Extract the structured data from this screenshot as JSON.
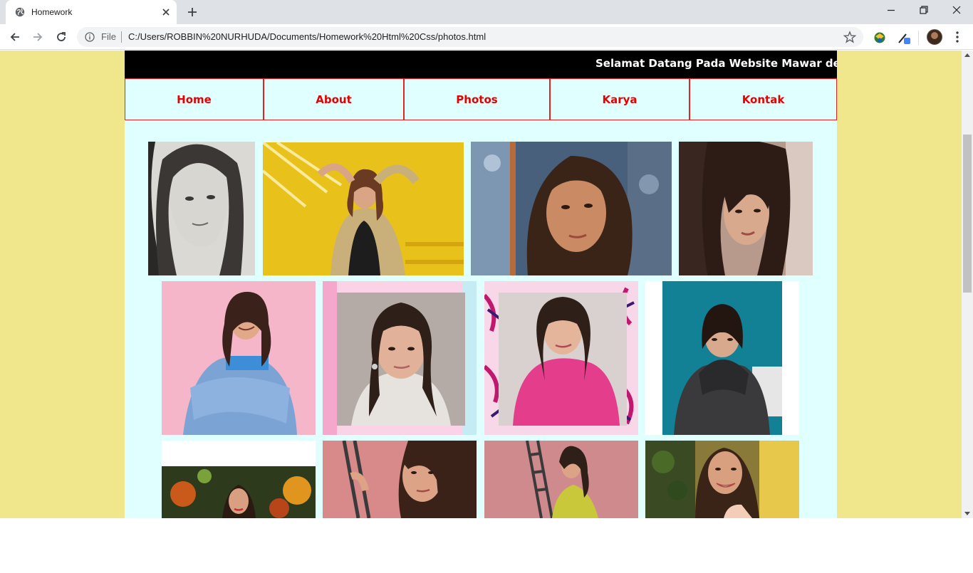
{
  "browser": {
    "tab_title": "Homework",
    "scheme_label": "File",
    "url": "C:/Users/ROBBIN%20NURHUDA/Documents/Homework%20Html%20Css/photos.html"
  },
  "page": {
    "marquee_text": "Selamat Datang Pada Website Mawar de Je",
    "nav": [
      "Home",
      "About",
      "Photos",
      "Karya",
      "Kontak"
    ]
  },
  "colors": {
    "page_background": "#f0e68c",
    "container_background": "#e0ffff",
    "nav_text": "#e60000",
    "nav_border": "#e32222",
    "marquee_background": "#000000"
  },
  "icons": [
    "globe-icon",
    "close-icon",
    "plus-icon",
    "minimize-icon",
    "restore-icon",
    "back-icon",
    "forward-icon",
    "reload-icon",
    "info-icon",
    "star-icon",
    "extension-icon",
    "avatar",
    "menu-icon"
  ]
}
